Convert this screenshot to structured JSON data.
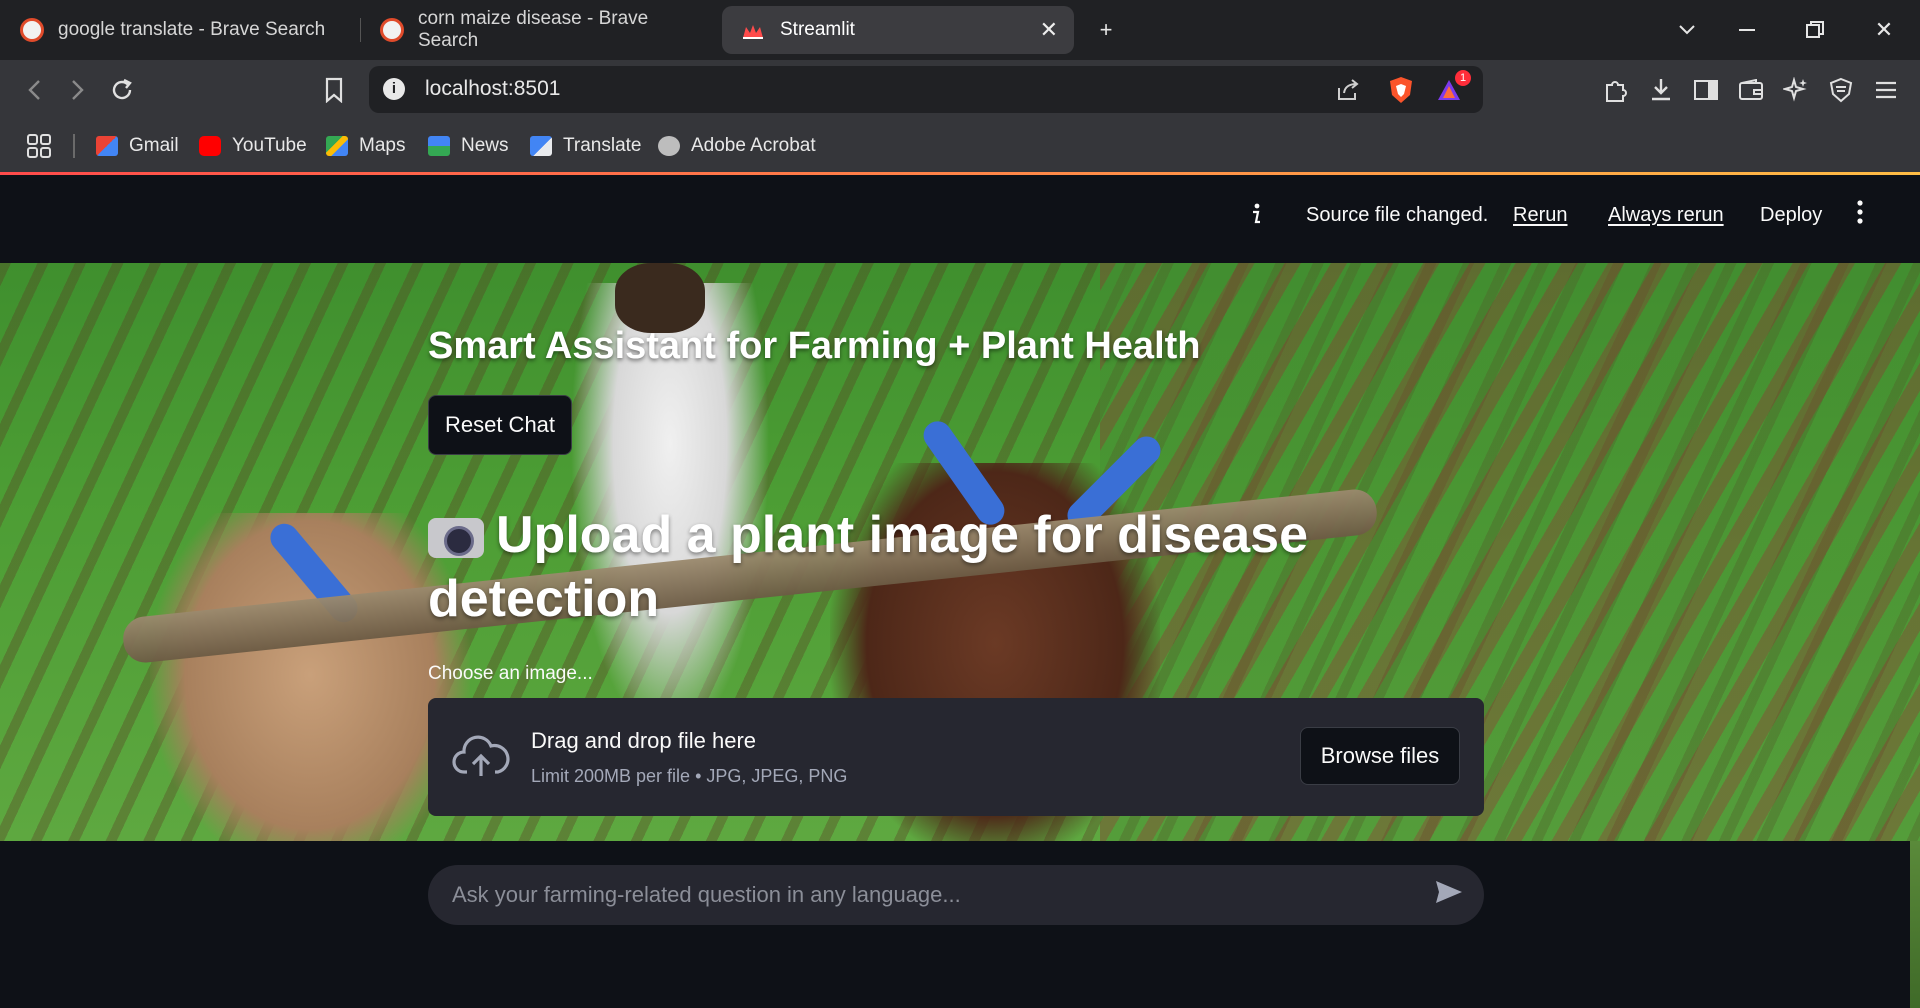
{
  "browser": {
    "tabs": [
      {
        "title": "google translate - Brave Search",
        "active": false
      },
      {
        "title": "corn maize disease - Brave Search",
        "active": false
      },
      {
        "title": "Streamlit",
        "active": true
      }
    ],
    "new_tab_label": "+",
    "url": "localhost:8501",
    "brave_rewards_badge": "1",
    "bookmarks": [
      {
        "label": "Gmail",
        "icon": "gmail-icon",
        "color": "#ea4335"
      },
      {
        "label": "YouTube",
        "icon": "youtube-icon",
        "color": "#ff0000"
      },
      {
        "label": "Maps",
        "icon": "maps-icon",
        "color": "#34a853"
      },
      {
        "label": "News",
        "icon": "news-icon",
        "color": "#4285f4"
      },
      {
        "label": "Translate",
        "icon": "translate-icon",
        "color": "#4285f4"
      },
      {
        "label": "Adobe Acrobat",
        "icon": "globe-icon",
        "color": "#cccccc"
      }
    ]
  },
  "streamlit_header": {
    "status": "Source file changed.",
    "rerun": "Rerun",
    "always_rerun": "Always rerun",
    "deploy": "Deploy"
  },
  "app": {
    "subtitle": "Smart Assistant for Farming + Plant Health",
    "reset_button": "Reset Chat",
    "upload_heading": "Upload a plant image for disease detection",
    "choose_label": "Choose an image...",
    "dropzone_title": "Drag and drop file here",
    "dropzone_limits": "Limit 200MB per file • JPG, JPEG, PNG",
    "browse_button": "Browse files",
    "chat_placeholder": "Ask your farming-related question in any language..."
  },
  "colors": {
    "accent": "#ff4b4b",
    "background": "#0e1117",
    "widget": "#262730"
  }
}
